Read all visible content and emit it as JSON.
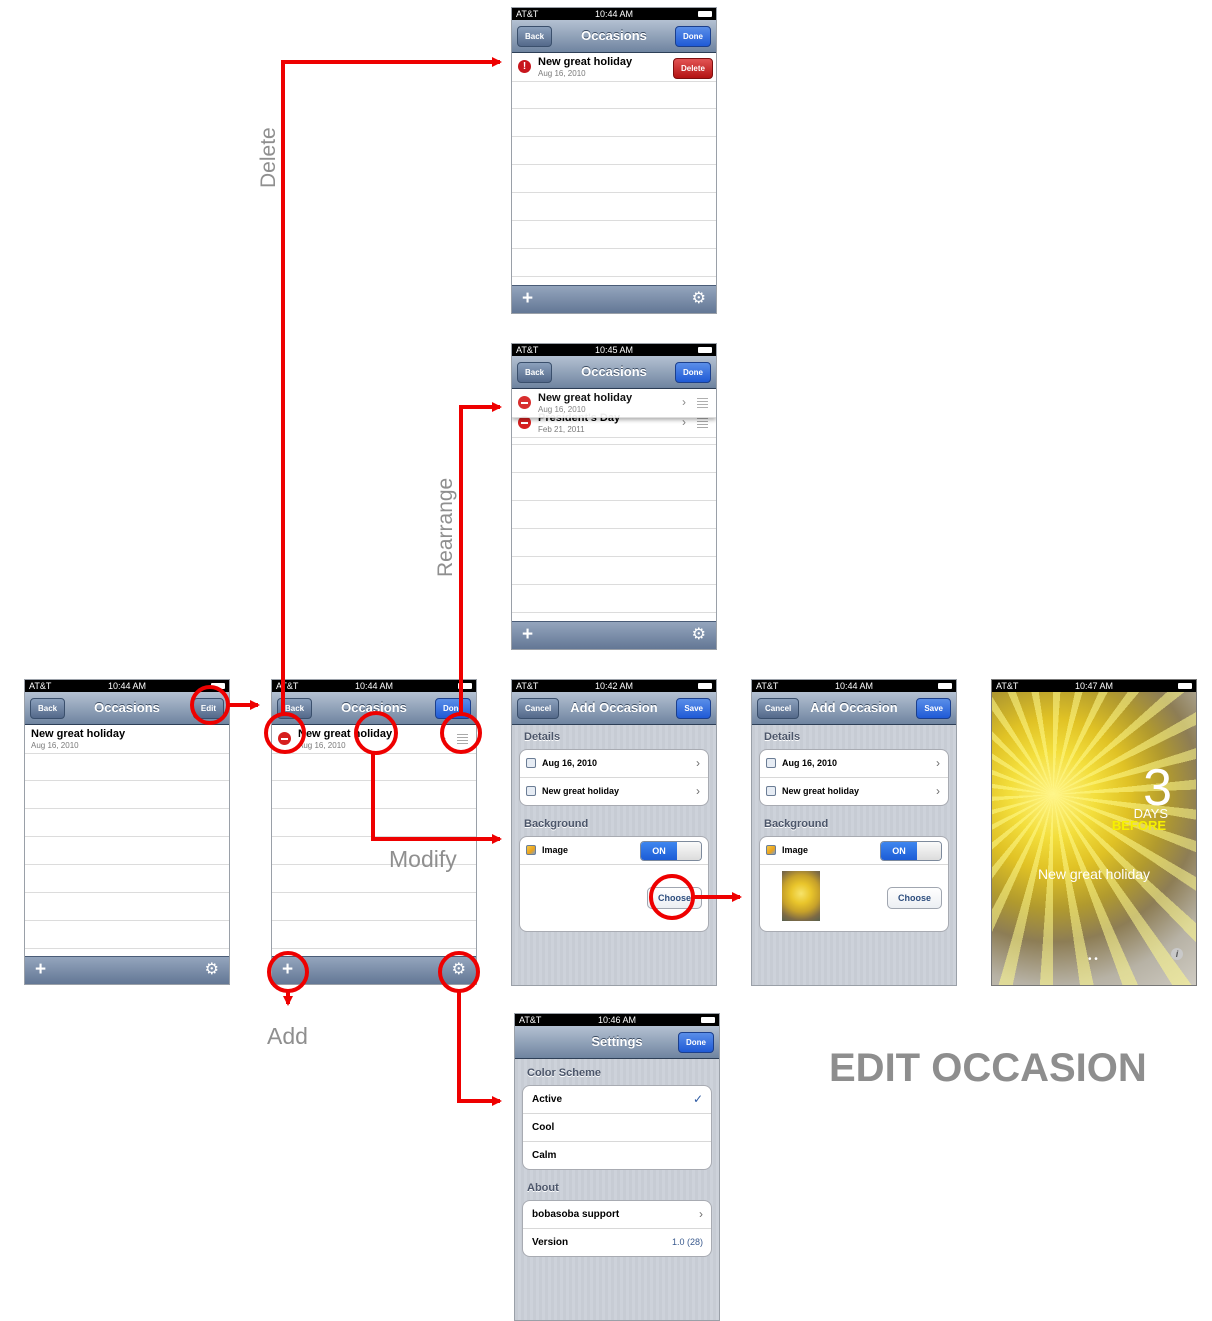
{
  "status": {
    "carrier": "AT&T",
    "times": {
      "s1": "10:44 AM",
      "s2": "10:45 AM",
      "s3": "10:44 AM",
      "s4": "10:44 AM",
      "s5": "10:42 AM",
      "s6": "10:44 AM",
      "s7": "10:47 AM",
      "s8": "10:46 AM"
    }
  },
  "nav": {
    "back": "Back",
    "edit": "Edit",
    "done": "Done",
    "cancel": "Cancel",
    "save": "Save",
    "occasions": "Occasions",
    "add_occasion": "Add Occasion",
    "settings": "Settings"
  },
  "rows": {
    "new_holiday": {
      "title": "New great holiday",
      "date": "Aug 16, 2010"
    },
    "presidents": {
      "title": "President's Day",
      "date": "Feb 21, 2011"
    },
    "delete_label": "Delete"
  },
  "add_occasion": {
    "details_header": "Details",
    "date_value": "Aug 16, 2010",
    "name_value": "New great holiday",
    "background_header": "Background",
    "image_label": "Image",
    "toggle_on": "ON",
    "choose": "Choose"
  },
  "countdown": {
    "number": "3",
    "days": "DAYS",
    "before": "BEFORE",
    "name": "New great holiday"
  },
  "settings": {
    "color_scheme_header": "Color Scheme",
    "schemes": [
      "Active",
      "Cool",
      "Calm"
    ],
    "about_header": "About",
    "support": "bobasoba support",
    "version_label": "Version",
    "version_value": "1.0 (28)"
  },
  "annotations": {
    "delete": "Delete",
    "rearrange": "Rearrange",
    "modify": "Modify",
    "add": "Add",
    "heading": "EDIT OCCASION"
  },
  "colors": {
    "accent_red": "#ee0000",
    "annotation_gray": "#8f8f8f",
    "nav_blue": "#6f84a0"
  },
  "icons": {
    "add": "plus-icon",
    "settings": "gear-icon",
    "row_delete": "minus-circle-icon",
    "reorder": "grip-icon",
    "disclosure": "chevron-right-icon"
  }
}
